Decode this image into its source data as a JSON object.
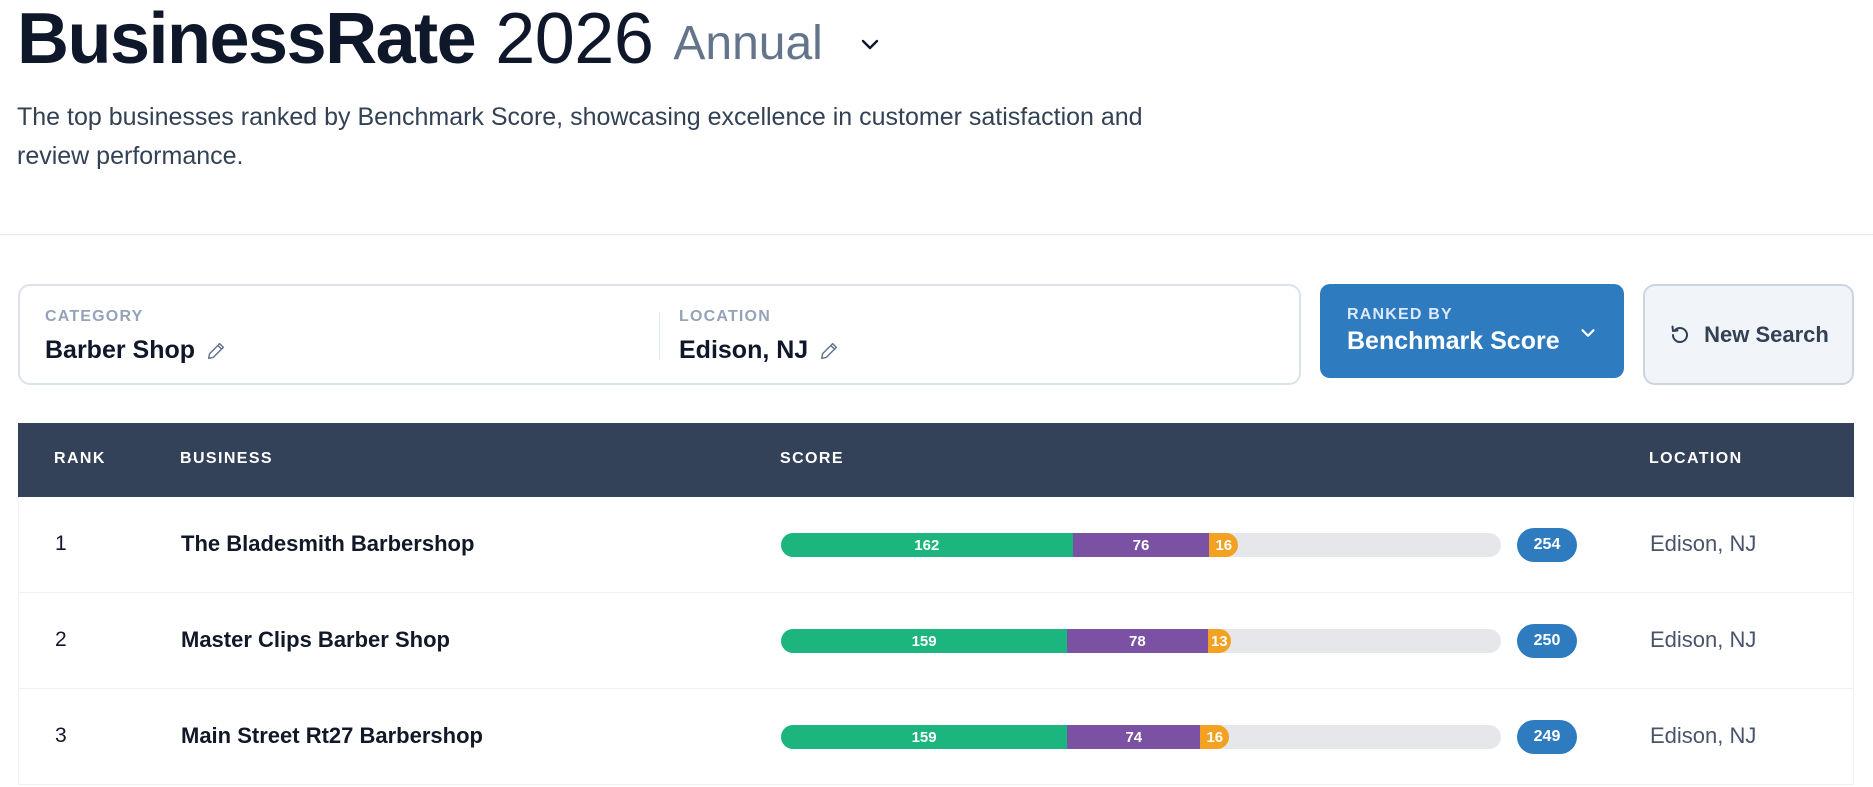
{
  "header": {
    "brand": "BusinessRate",
    "year": "2026",
    "period": "Annual",
    "subtitle": "The top businesses ranked by Benchmark Score, showcasing excellence in customer satisfaction and review performance."
  },
  "search": {
    "category_label": "CATEGORY",
    "category_value": "Barber Shop",
    "location_label": "LOCATION",
    "location_value": "Edison, NJ",
    "ranked_by_label": "RANKED BY",
    "ranked_by_value": "Benchmark Score",
    "new_search_label": "New Search"
  },
  "table": {
    "headers": {
      "rank": "RANK",
      "business": "BUSINESS",
      "score": "SCORE",
      "location": "LOCATION"
    },
    "score_max": 400,
    "rows": [
      {
        "rank": "1",
        "business": "The Bladesmith Barbershop",
        "green": 162,
        "purple": 76,
        "orange": 16,
        "total": "254",
        "location": "Edison, NJ"
      },
      {
        "rank": "2",
        "business": "Master Clips Barber Shop",
        "green": 159,
        "purple": 78,
        "orange": 13,
        "total": "250",
        "location": "Edison, NJ"
      },
      {
        "rank": "3",
        "business": "Main Street Rt27 Barbershop",
        "green": 159,
        "purple": 74,
        "orange": 16,
        "total": "249",
        "location": "Edison, NJ"
      }
    ]
  },
  "colors": {
    "accent": "#2f7bbf",
    "header_bg": "#334258",
    "green": "#1db57e",
    "purple": "#7b52a3",
    "orange": "#f2a122"
  },
  "icons": {
    "period_dropdown": "chevron-down-icon",
    "edit": "pencil-icon",
    "ranked_dropdown": "chevron-down-icon",
    "new_search": "refresh-icon"
  }
}
